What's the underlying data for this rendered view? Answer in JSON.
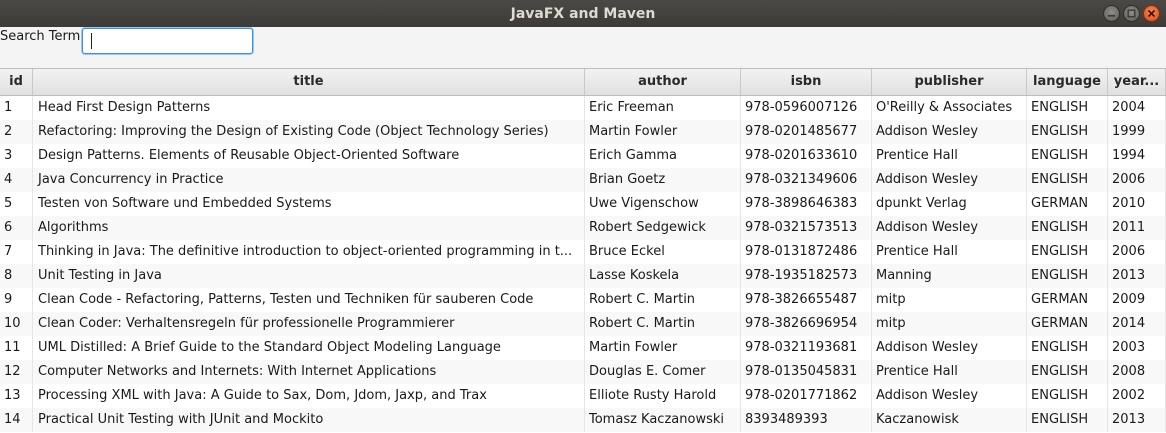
{
  "window": {
    "title": "JavaFX and Maven"
  },
  "search": {
    "label": "Search Term",
    "value": "",
    "placeholder": ""
  },
  "table": {
    "columns": [
      "id",
      "title",
      "author",
      "isbn",
      "publisher",
      "language",
      "year..."
    ],
    "rows": [
      [
        "1",
        "Head First Design Patterns",
        "Eric Freeman",
        "978-0596007126",
        "O'Reilly & Associates",
        "ENGLISH",
        "2004"
      ],
      [
        "2",
        "Refactoring: Improving the Design of Existing Code (Object Technology Series)",
        "Martin Fowler",
        "978-0201485677",
        "Addison Wesley",
        "ENGLISH",
        "1999"
      ],
      [
        "3",
        "Design Patterns. Elements of Reusable Object-Oriented Software",
        "Erich Gamma",
        "978-0201633610",
        "Prentice Hall",
        "ENGLISH",
        "1994"
      ],
      [
        "4",
        "Java Concurrency in Practice",
        "Brian Goetz",
        "978-0321349606",
        "Addison Wesley",
        "ENGLISH",
        "2006"
      ],
      [
        "5",
        "Testen von Software und Embedded Systems",
        "Uwe Vigenschow",
        "978-3898646383",
        "dpunkt Verlag",
        "GERMAN",
        "2010"
      ],
      [
        "6",
        "Algorithms",
        "Robert Sedgewick",
        "978-0321573513",
        "Addison Wesley",
        "ENGLISH",
        "2011"
      ],
      [
        "7",
        "Thinking in Java: The definitive introduction to object-oriented programming in t...",
        "Bruce Eckel",
        "978-0131872486",
        "Prentice Hall",
        "ENGLISH",
        "2006"
      ],
      [
        "8",
        "Unit Testing in Java",
        "Lasse Koskela",
        "978-1935182573",
        "Manning",
        "ENGLISH",
        "2013"
      ],
      [
        "9",
        "Clean Code - Refactoring, Patterns, Testen und Techniken für sauberen Code",
        "Robert C. Martin",
        "978-3826655487",
        "mitp",
        "GERMAN",
        "2009"
      ],
      [
        "10",
        "Clean Coder: Verhaltensregeln für professionelle Programmierer",
        "Robert C. Martin",
        "978-3826696954",
        "mitp",
        "GERMAN",
        "2014"
      ],
      [
        "11",
        "UML Distilled: A Brief Guide to the Standard Object Modeling Language",
        "Martin Fowler",
        "978-0321193681",
        "Addison Wesley",
        "ENGLISH",
        "2003"
      ],
      [
        "12",
        "Computer Networks and Internets: With Internet Applications",
        "Douglas E. Comer",
        "978-0135045831",
        "Prentice Hall",
        "ENGLISH",
        "2008"
      ],
      [
        "13",
        "Processing XML with Java: A Guide to Sax, Dom, Jdom, Jaxp, and Trax",
        "Elliote Rusty Harold",
        "978-0201771862",
        "Addison Wesley",
        "ENGLISH",
        "2002"
      ],
      [
        "14",
        "Practical Unit Testing with JUnit and Mockito",
        "Tomasz Kaczanowski",
        "8393489393",
        "Kaczanowisk",
        "ENGLISH",
        "2013"
      ]
    ]
  },
  "colors": {
    "titlebar": "#3c3b37",
    "close_button": "#dd4814",
    "focus_ring": "#3d8fe8"
  },
  "icons": {
    "minimize": "minimize-icon",
    "maximize": "maximize-icon",
    "close": "close-icon"
  }
}
